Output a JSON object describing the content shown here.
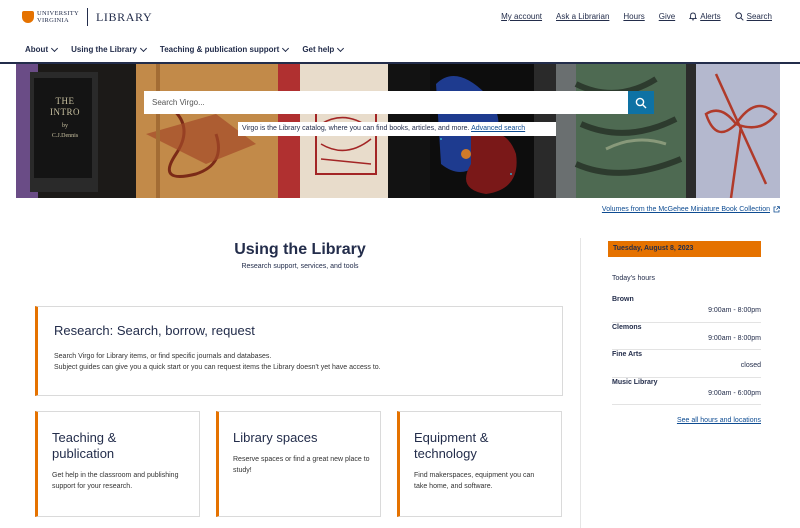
{
  "header": {
    "logo_line1": "UNIVERSITY",
    "logo_line2": "VIRGINIA",
    "logo_library": "LIBRARY",
    "utility": [
      {
        "label": "My account"
      },
      {
        "label": "Ask a Librarian"
      },
      {
        "label": "Hours"
      },
      {
        "label": "Give"
      },
      {
        "label": "Alerts",
        "icon": "bell-icon"
      },
      {
        "label": "Search",
        "icon": "search-icon"
      }
    ],
    "nav": [
      "About",
      "Using the Library",
      "Teaching & publication support",
      "Get help"
    ]
  },
  "hero": {
    "search_placeholder": "Search Virgo...",
    "help_text": "Virgo is the Library catalog, where you can find books, articles, and more.",
    "help_link": "Advanced search",
    "book_title": "THE INTRO",
    "book_by": "by",
    "book_author": "C.J.Dennis",
    "caption": "Volumes from the McGehee Miniature Book Collection"
  },
  "main": {
    "title": "Using the Library",
    "subtitle": "Research support, services, and tools",
    "research_card": {
      "title": "Research: Search, borrow, request",
      "line1": "Search Virgo for Library items, or find specific journals and databases.",
      "line2": "Subject guides can give you a quick start or you can request items the Library doesn't yet have access to."
    },
    "cards": [
      {
        "title": "Teaching & publication",
        "text": "Get help in the classroom and publishing support for your research."
      },
      {
        "title": "Library spaces",
        "text": "Reserve spaces or find a great new place to study!"
      },
      {
        "title": "Equipment & technology",
        "text": "Find makerspaces, equipment you can take home, and software."
      }
    ]
  },
  "hours": {
    "date": "Tuesday, August 8, 2023",
    "title": "Today's hours",
    "locations": [
      {
        "name": "Brown",
        "time": "9:00am - 8:00pm"
      },
      {
        "name": "Clemons",
        "time": "9:00am - 8:00pm"
      },
      {
        "name": "Fine Arts",
        "time": "closed"
      },
      {
        "name": "Music Library",
        "time": "9:00am - 6:00pm"
      }
    ],
    "all_link": "See all hours and locations"
  },
  "colors": {
    "navy": "#232d4b",
    "orange": "#e57200",
    "search_blue": "#0e72a4",
    "link": "#0e4c92"
  }
}
